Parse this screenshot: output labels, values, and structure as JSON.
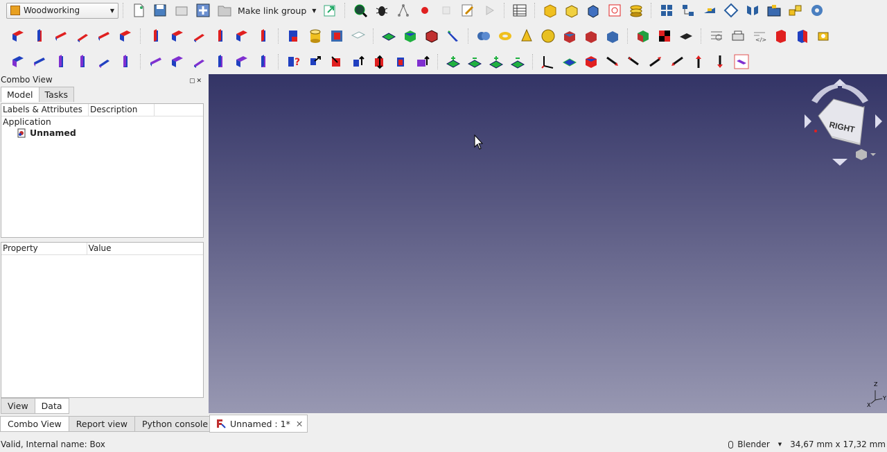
{
  "toolbar": {
    "workbench": "Woodworking",
    "link_group": "Make link group"
  },
  "combo_view": {
    "title": "Combo View",
    "tabs": [
      "Model",
      "Tasks"
    ],
    "tree_headers": [
      "Labels & Attributes",
      "Description"
    ],
    "tree": {
      "application": "Application",
      "document": "Unnamed"
    },
    "property_headers": [
      "Property",
      "Value"
    ],
    "sub_tabs": [
      "View",
      "Data"
    ]
  },
  "bottom_tabs": [
    "Combo View",
    "Report view",
    "Python console"
  ],
  "document_tab": {
    "label": "Unnamed : 1*"
  },
  "navcube": {
    "face": "RIGHT"
  },
  "status": {
    "message": "Valid, Internal name: Box",
    "nav_style": "Blender",
    "dimensions": "34,67 mm x 17,32 mm"
  },
  "colors": {
    "viewport_top": "#333466",
    "viewport_bottom": "#9898b2",
    "accent_red": "#e02020",
    "accent_blue": "#2040c0"
  }
}
